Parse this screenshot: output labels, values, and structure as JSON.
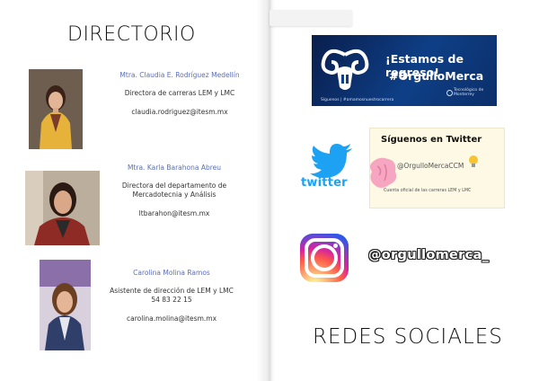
{
  "left_page": {
    "title": "DIRECTORIO",
    "contacts": [
      {
        "name": "Mtra. Claudia E. Rodríguez Medellín",
        "role": "Directora de carreras LEM y LMC",
        "email": "claudia.rodriguez@itesm.mx"
      },
      {
        "name": "Mtra. Karla Barahona Abreu",
        "role": "Directora del departamento de Mercadotecnia y Análisis",
        "email": "ltbarahon@itesm.mx"
      },
      {
        "name": "Carolina Molina Ramos",
        "role": "Asistente de dirección de LEM y LMC",
        "phone": "54 83 22 15",
        "email": "carolina.molina@itesm.mx"
      }
    ]
  },
  "right_page": {
    "title": "REDES SOCIALES",
    "banner": {
      "line1": "¡Estamos de regreso!",
      "line2": "#OrgulloMerca",
      "small_text": "Síguenos | #amamosnuestrocarrera",
      "institution": "Tecnológico de Monterrey"
    },
    "twitter": {
      "wordmark": "twitter",
      "card_heading": "Síguenos en Twitter",
      "card_handle": "@OrgulloMercaCCM",
      "card_subtitle": "Cuenta oficial de las carreras LEM y LMC"
    },
    "instagram": {
      "handle": "@orgullomerca_"
    }
  },
  "colors": {
    "name_blue": "#5b6fb6",
    "twitter_blue": "#1da1f2",
    "banner_navy": "#0e3f86"
  }
}
